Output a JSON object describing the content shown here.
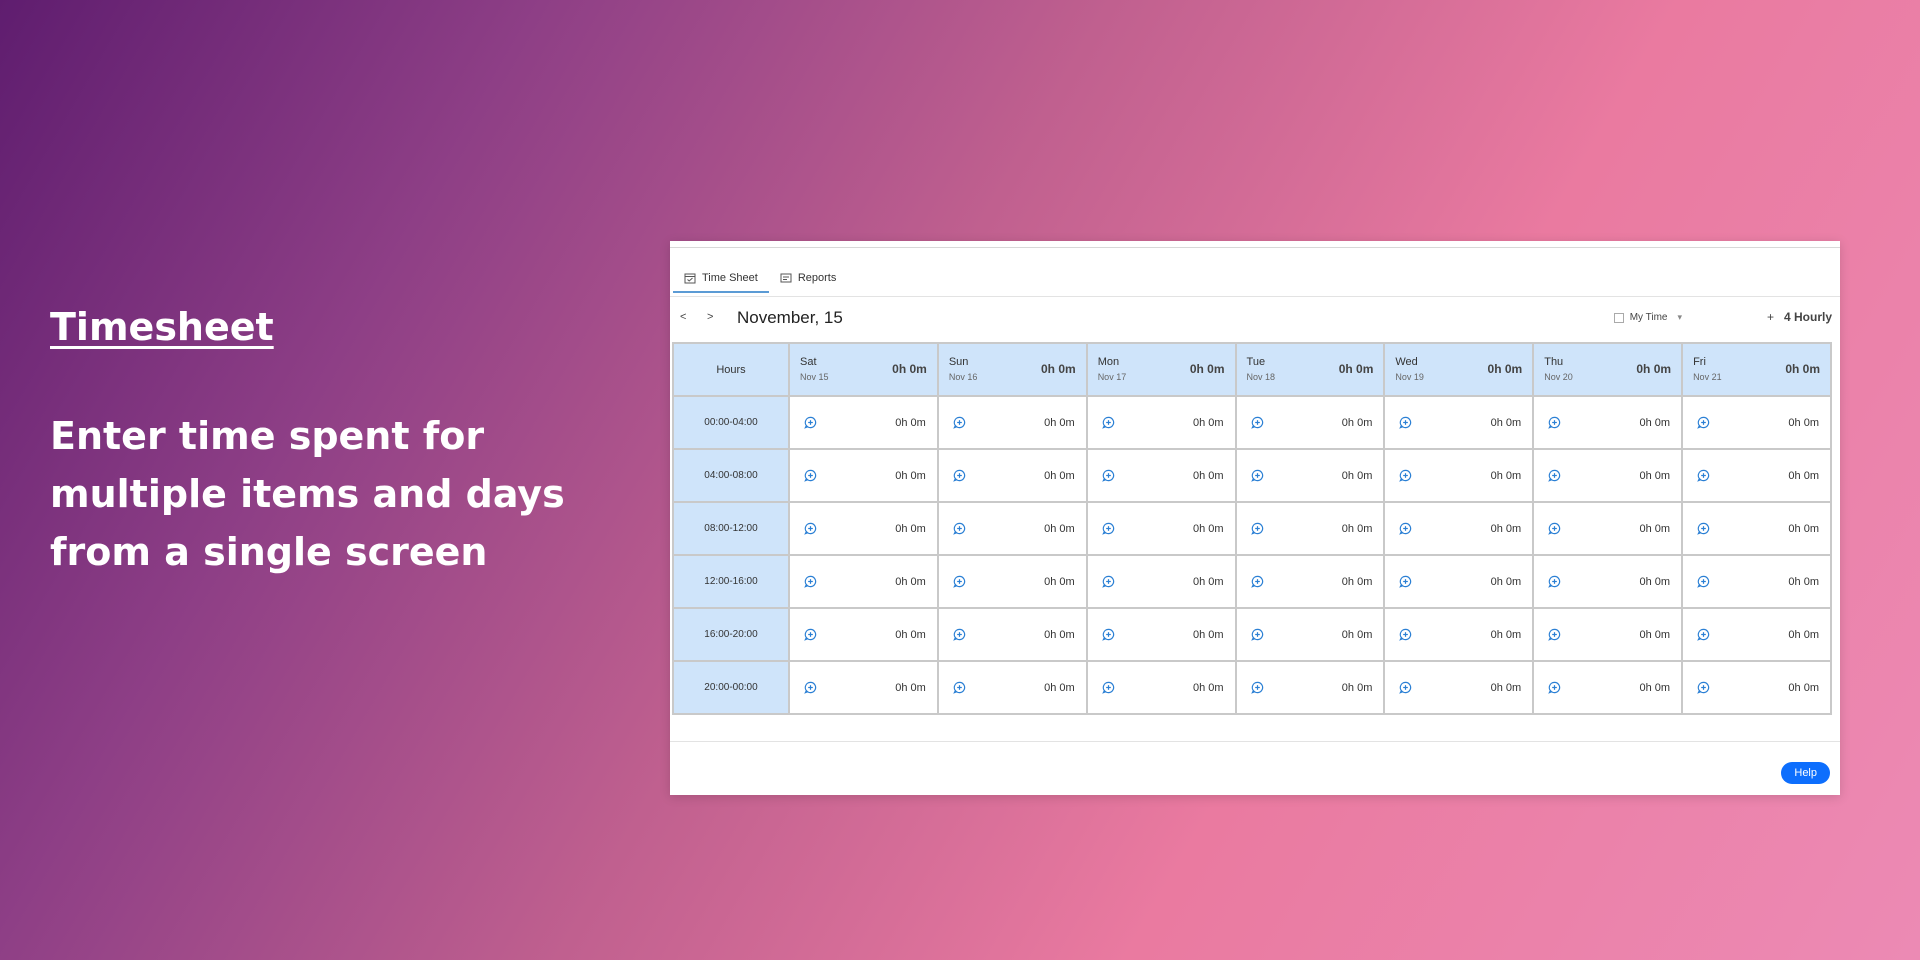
{
  "promo": {
    "title": "Timesheet",
    "description": "Enter time spent for multiple items and days from a single screen"
  },
  "tabs": [
    {
      "label": "Time Sheet",
      "icon": "calendar-check-icon",
      "active": true
    },
    {
      "label": "Reports",
      "icon": "report-icon",
      "active": false
    }
  ],
  "toolbar": {
    "prev_label": "<",
    "next_label": ">",
    "date_title": "November, 15",
    "my_time_label": "My Time",
    "my_time_caret": "▾",
    "hourly_plus": "+",
    "hourly_label": "4 Hourly"
  },
  "grid": {
    "hours_header": "Hours",
    "days": [
      {
        "name": "Sat",
        "date": "Nov 15",
        "total": "0h 0m"
      },
      {
        "name": "Sun",
        "date": "Nov 16",
        "total": "0h 0m"
      },
      {
        "name": "Mon",
        "date": "Nov 17",
        "total": "0h 0m"
      },
      {
        "name": "Tue",
        "date": "Nov 18",
        "total": "0h 0m"
      },
      {
        "name": "Wed",
        "date": "Nov 19",
        "total": "0h 0m"
      },
      {
        "name": "Thu",
        "date": "Nov 20",
        "total": "0h 0m"
      },
      {
        "name": "Fri",
        "date": "Nov 21",
        "total": "0h 0m"
      }
    ],
    "slots": [
      {
        "label": "00:00-04:00",
        "values": [
          "0h 0m",
          "0h 0m",
          "0h 0m",
          "0h 0m",
          "0h 0m",
          "0h 0m",
          "0h 0m"
        ]
      },
      {
        "label": "04:00-08:00",
        "values": [
          "0h 0m",
          "0h 0m",
          "0h 0m",
          "0h 0m",
          "0h 0m",
          "0h 0m",
          "0h 0m"
        ]
      },
      {
        "label": "08:00-12:00",
        "values": [
          "0h 0m",
          "0h 0m",
          "0h 0m",
          "0h 0m",
          "0h 0m",
          "0h 0m",
          "0h 0m"
        ]
      },
      {
        "label": "12:00-16:00",
        "values": [
          "0h 0m",
          "0h 0m",
          "0h 0m",
          "0h 0m",
          "0h 0m",
          "0h 0m",
          "0h 0m"
        ]
      },
      {
        "label": "16:00-20:00",
        "values": [
          "0h 0m",
          "0h 0m",
          "0h 0m",
          "0h 0m",
          "0h 0m",
          "0h 0m",
          "0h 0m"
        ]
      },
      {
        "label": "20:00-00:00",
        "values": [
          "0h 0m",
          "0h 0m",
          "0h 0m",
          "0h 0m",
          "0h 0m",
          "0h 0m",
          "0h 0m"
        ]
      }
    ]
  },
  "help": {
    "label": "Help"
  },
  "colors": {
    "accent": "#0d6efd",
    "header_bg": "#cfe4fa",
    "icon_blue": "#2a7fd4"
  }
}
